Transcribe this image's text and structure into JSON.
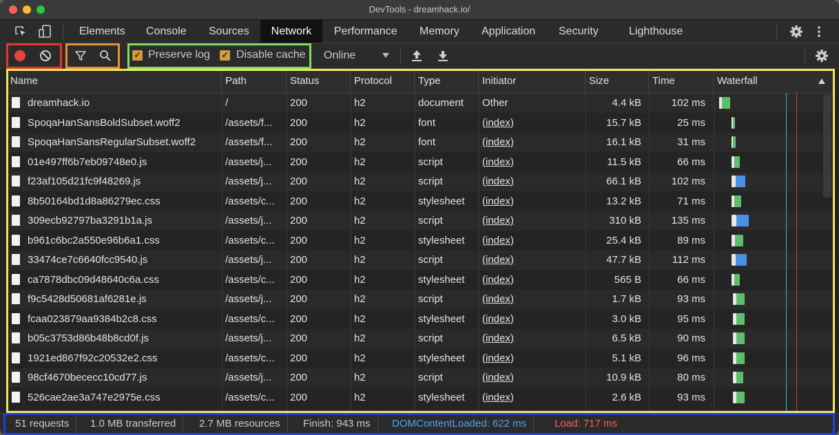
{
  "window": {
    "title": "DevTools - dreamhack.io/"
  },
  "tabs": [
    "Elements",
    "Console",
    "Sources",
    "Network",
    "Performance",
    "Memory",
    "Application",
    "Security",
    "Lighthouse"
  ],
  "active_tab": "Network",
  "toolbar": {
    "preserve_log": "Preserve log",
    "disable_cache": "Disable cache",
    "throttle": "Online"
  },
  "columns": {
    "name": "Name",
    "path": "Path",
    "status": "Status",
    "protocol": "Protocol",
    "type": "Type",
    "initiator": "Initiator",
    "size": "Size",
    "time": "Time",
    "waterfall": "Waterfall"
  },
  "requests": [
    {
      "name": "dreamhack.io",
      "path": "/",
      "status": "200",
      "protocol": "h2",
      "type": "document",
      "initiator": "Other",
      "size": "4.4 kB",
      "time": "102 ms",
      "wf_start": 0,
      "wf_wait": 4,
      "wf_dl": 12
    },
    {
      "name": "SpoqaHanSansBoldSubset.woff2",
      "path": "/assets/f...",
      "status": "200",
      "protocol": "h2",
      "type": "font",
      "initiator": "(index)",
      "size": "15.7 kB",
      "time": "25 ms",
      "wf_start": 18,
      "wf_wait": 2,
      "wf_dl": 3
    },
    {
      "name": "SpoqaHanSansRegularSubset.woff2",
      "path": "/assets/f...",
      "status": "200",
      "protocol": "h2",
      "type": "font",
      "initiator": "(index)",
      "size": "16.1 kB",
      "time": "31 ms",
      "wf_start": 18,
      "wf_wait": 2,
      "wf_dl": 4
    },
    {
      "name": "01e497ff6b7eb09748e0.js",
      "path": "/assets/j...",
      "status": "200",
      "protocol": "h2",
      "type": "script",
      "initiator": "(index)",
      "size": "11.5 kB",
      "time": "66 ms",
      "wf_start": 18,
      "wf_wait": 4,
      "wf_dl": 8
    },
    {
      "name": "f23af105d21fc9f48269.js",
      "path": "/assets/j...",
      "status": "200",
      "protocol": "h2",
      "type": "script",
      "initiator": "(index)",
      "size": "66.1 kB",
      "time": "102 ms",
      "wf_start": 18,
      "wf_wait": 6,
      "wf_dl": 14
    },
    {
      "name": "8b50164bd1d8a86279ec.css",
      "path": "/assets/c...",
      "status": "200",
      "protocol": "h2",
      "type": "stylesheet",
      "initiator": "(index)",
      "size": "13.2 kB",
      "time": "71 ms",
      "wf_start": 18,
      "wf_wait": 4,
      "wf_dl": 10
    },
    {
      "name": "309ecb92797ba3291b1a.js",
      "path": "/assets/j...",
      "status": "200",
      "protocol": "h2",
      "type": "script",
      "initiator": "(index)",
      "size": "310 kB",
      "time": "135 ms",
      "wf_start": 18,
      "wf_wait": 7,
      "wf_dl": 18
    },
    {
      "name": "b961c6bc2a550e96b6a1.css",
      "path": "/assets/c...",
      "status": "200",
      "protocol": "h2",
      "type": "stylesheet",
      "initiator": "(index)",
      "size": "25.4 kB",
      "time": "89 ms",
      "wf_start": 18,
      "wf_wait": 5,
      "wf_dl": 12
    },
    {
      "name": "33474ce7c6640fcc9540.js",
      "path": "/assets/j...",
      "status": "200",
      "protocol": "h2",
      "type": "script",
      "initiator": "(index)",
      "size": "47.7 kB",
      "time": "112 ms",
      "wf_start": 18,
      "wf_wait": 6,
      "wf_dl": 16
    },
    {
      "name": "ca7878dbc09d48640c6a.css",
      "path": "/assets/c...",
      "status": "200",
      "protocol": "h2",
      "type": "stylesheet",
      "initiator": "(index)",
      "size": "565 B",
      "time": "66 ms",
      "wf_start": 18,
      "wf_wait": 4,
      "wf_dl": 8
    },
    {
      "name": "f9c5428d50681af6281e.js",
      "path": "/assets/j...",
      "status": "200",
      "protocol": "h2",
      "type": "script",
      "initiator": "(index)",
      "size": "1.7 kB",
      "time": "93 ms",
      "wf_start": 20,
      "wf_wait": 5,
      "wf_dl": 12
    },
    {
      "name": "fcaa023879aa9384b2c8.css",
      "path": "/assets/c...",
      "status": "200",
      "protocol": "h2",
      "type": "stylesheet",
      "initiator": "(index)",
      "size": "3.0 kB",
      "time": "95 ms",
      "wf_start": 20,
      "wf_wait": 5,
      "wf_dl": 12
    },
    {
      "name": "b05c3753d86b48b8cd0f.js",
      "path": "/assets/j...",
      "status": "200",
      "protocol": "h2",
      "type": "script",
      "initiator": "(index)",
      "size": "6.5 kB",
      "time": "90 ms",
      "wf_start": 20,
      "wf_wait": 5,
      "wf_dl": 12
    },
    {
      "name": "1921ed867f92c20532e2.css",
      "path": "/assets/c...",
      "status": "200",
      "protocol": "h2",
      "type": "stylesheet",
      "initiator": "(index)",
      "size": "5.1 kB",
      "time": "96 ms",
      "wf_start": 20,
      "wf_wait": 5,
      "wf_dl": 12
    },
    {
      "name": "98cf4670bececc10cd77.js",
      "path": "/assets/j...",
      "status": "200",
      "protocol": "h2",
      "type": "script",
      "initiator": "(index)",
      "size": "10.9 kB",
      "time": "80 ms",
      "wf_start": 20,
      "wf_wait": 5,
      "wf_dl": 10
    },
    {
      "name": "526cae2ae3a747e2975e.css",
      "path": "/assets/c...",
      "status": "200",
      "protocol": "h2",
      "type": "stylesheet",
      "initiator": "(index)",
      "size": "2.6 kB",
      "time": "93 ms",
      "wf_start": 20,
      "wf_wait": 5,
      "wf_dl": 12
    }
  ],
  "statusbar": {
    "requests": "51 requests",
    "transferred": "1.0 MB transferred",
    "resources": "2.7 MB resources",
    "finish": "Finish: 943 ms",
    "dcl": "DOMContentLoaded: 622 ms",
    "load": "Load: 717 ms"
  },
  "colors": {
    "record": "#e8453c",
    "dcl": "#4aa3f0",
    "load": "#f0625a",
    "wf_wait": "#5cbd6a",
    "wf_download": "#4a90e2",
    "highlight_red": "#e0392f",
    "highlight_orange": "#e8922f",
    "highlight_green": "#7be05a",
    "highlight_yellow": "#f4e85a",
    "highlight_blue": "#1f3fe0"
  }
}
